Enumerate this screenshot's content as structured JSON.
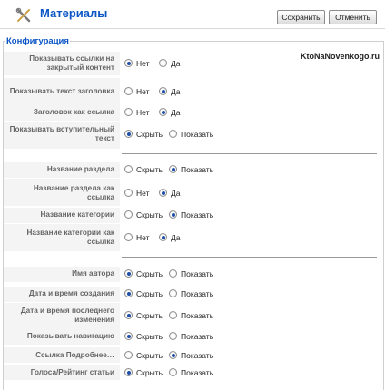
{
  "header": {
    "title": "Материалы",
    "save_label": "Сохранить",
    "cancel_label": "Отменить"
  },
  "section": {
    "title": "Конфигурация"
  },
  "watermark": "KtoNaNovenkogo.ru",
  "rows": [
    {
      "label": "Показывать ссылки на закрытый контент",
      "options": [
        "Нет",
        "Да"
      ],
      "selected": 0
    },
    {
      "label": "Показывать текст заголовка",
      "options": [
        "Нет",
        "Да"
      ],
      "selected": 1
    },
    {
      "label": "Заголовок как ссылка",
      "options": [
        "Нет",
        "Да"
      ],
      "selected": 1
    },
    {
      "label": "Показывать вступительный текст",
      "options": [
        "Скрыть",
        "Показать"
      ],
      "selected": 0
    },
    {
      "label": "Название раздела",
      "options": [
        "Скрыть",
        "Показать"
      ],
      "selected": 1
    },
    {
      "label": "Название раздела как ссылка",
      "options": [
        "Нет",
        "Да"
      ],
      "selected": 1
    },
    {
      "label": "Название категории",
      "options": [
        "Скрыть",
        "Показать"
      ],
      "selected": 1
    },
    {
      "label": "Название категории как ссылка",
      "options": [
        "Нет",
        "Да"
      ],
      "selected": 1
    },
    {
      "label": "Имя автора",
      "options": [
        "Скрыть",
        "Показать"
      ],
      "selected": 0
    },
    {
      "label": "Дата и время создания",
      "options": [
        "Скрыть",
        "Показать"
      ],
      "selected": 0
    },
    {
      "label": "Дата и время последнего изменения",
      "options": [
        "Скрыть",
        "Показать"
      ],
      "selected": 0
    },
    {
      "label": "Показывать навигацию",
      "options": [
        "Скрыть",
        "Показать"
      ],
      "selected": 0
    },
    {
      "label": "Ссылка Подробнее…",
      "options": [
        "Скрыть",
        "Показать"
      ],
      "selected": 1
    },
    {
      "label": "Голоса/Рейтинг статьи",
      "options": [
        "Скрыть",
        "Показать"
      ],
      "selected": 0
    }
  ]
}
